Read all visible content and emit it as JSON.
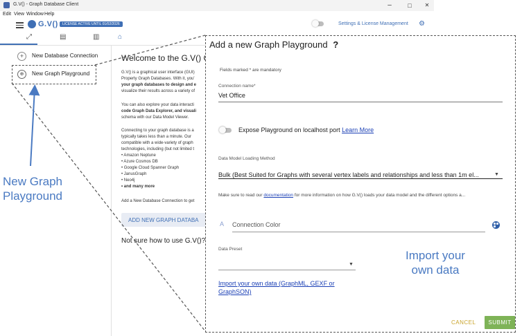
{
  "window": {
    "title": "G.V() - Graph Database Client",
    "controls": {
      "minimize": "–",
      "maximize": "□",
      "close": "✕"
    }
  },
  "menu": {
    "items": [
      "Edit",
      "View",
      "Window",
      "Help"
    ]
  },
  "header": {
    "brand": "G.V()",
    "license_badge": "LICENSE ACTIVE UNTIL 01/02/2026",
    "settings_link": "Settings & License Management"
  },
  "sidebar": {
    "items": [
      {
        "label": "New Database Connection",
        "icon": "plus-circle-icon"
      },
      {
        "label": "New Graph Playground",
        "icon": "globe-icon"
      }
    ]
  },
  "main": {
    "welcome_title": "Welcome to the G.V() Graph",
    "paragraphs": [
      "G.V() is a graphical user interface (GUI)",
      "Property Graph Databases. With it, you'",
      "your graph databases to design and e",
      "visualize their results across a variety of",
      "You can also explore your data interacti",
      "code Graph Data Explorer, and visuali",
      "schema with our Data Model Viewer.",
      "Connecting to your graph database is a",
      "typically takes less than a minute. Our",
      "compatible with a wide-variety of graph",
      "technologies, including (but not limited t",
      "• Amazon Neptune",
      "• Azure Cosmos DB",
      "• Google Cloud Spanner Graph",
      "• JanusGraph",
      "• Neo4j",
      "• and many more",
      "Add a New Database Connection to get"
    ],
    "add_button": "ADD NEW GRAPH DATABA",
    "not_sure": "Not sure how to use G.V()?"
  },
  "dialog": {
    "title": "Add a new Graph Playground",
    "help_icon": "?",
    "mandatory_note": "Fields marked * are mandatory",
    "connection_name": {
      "label": "Connection name*",
      "value": "Vet Office"
    },
    "expose": {
      "label": "Expose Playground on localhost port",
      "link": "Learn More"
    },
    "data_model": {
      "label": "Data Model Loading Method",
      "value": "Bulk (Best Suited for Graphs with several vertex labels and relationships and less than 1m el..."
    },
    "note_prefix": "Make sure to read our",
    "note_link": "documentation",
    "note_suffix": "for more information on how G.V() loads your data model and the different options a...",
    "connection_color": {
      "letter": "A",
      "label": "Connection Color"
    },
    "data_preset": {
      "label": "Data Preset",
      "value": ""
    },
    "import_link": "Import your own data (GraphML, GEXF or GraphSON)",
    "cancel": "CANCEL",
    "submit": "SUBMIT"
  },
  "annotations": {
    "left": "New Graph Playground",
    "right": "Import your own data"
  },
  "colors": {
    "brand": "#3f6fb5",
    "annotation": "#4a7ac2",
    "submit": "#7eb357",
    "cancel": "#c9a32a",
    "link": "#1a3fb5"
  }
}
